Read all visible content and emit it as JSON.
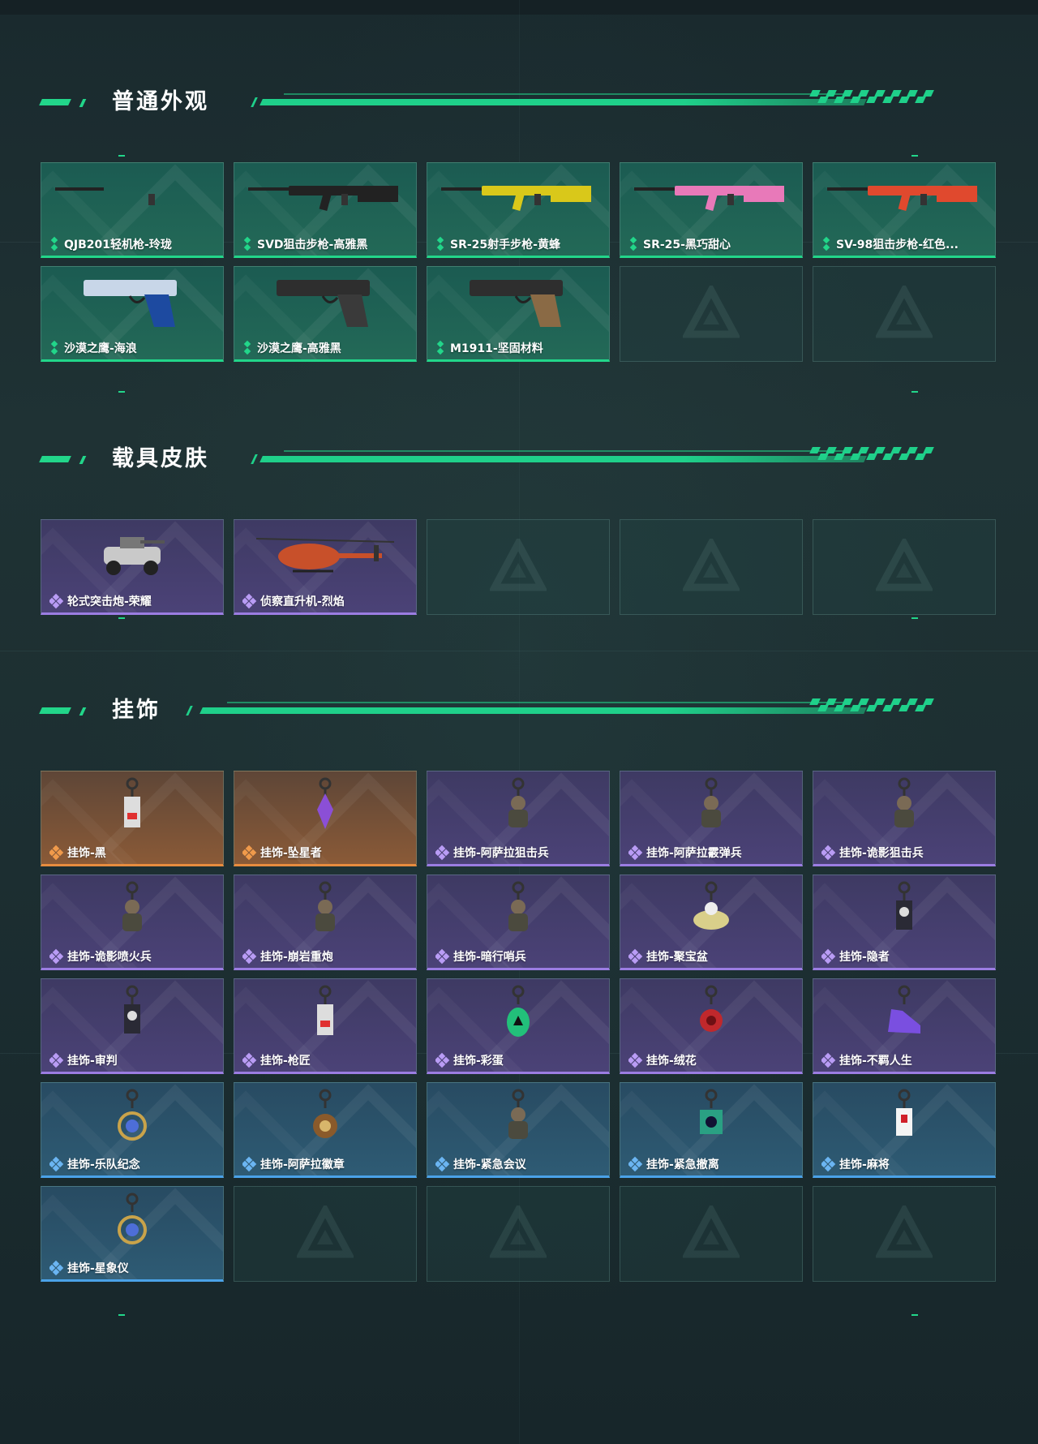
{
  "sections": {
    "skins": {
      "title": "普通外观",
      "items": [
        {
          "name": "QJB201轻机枪-玲珑",
          "rarity": "green",
          "icon": "machine-gun-icon"
        },
        {
          "name": "SVD狙击步枪-高雅黑",
          "rarity": "green",
          "icon": "sniper-rifle-icon"
        },
        {
          "name": "SR-25射手步枪-黄蜂",
          "rarity": "green",
          "icon": "marksman-rifle-yellow-icon"
        },
        {
          "name": "SR-25-黑巧甜心",
          "rarity": "green",
          "icon": "marksman-rifle-pink-icon"
        },
        {
          "name": "SV-98狙击步枪-红色...",
          "rarity": "green",
          "icon": "sniper-rifle-red-icon"
        },
        {
          "name": "沙漠之鹰-海浪",
          "rarity": "green",
          "icon": "pistol-blue-icon"
        },
        {
          "name": "沙漠之鹰-高雅黑",
          "rarity": "green",
          "icon": "pistol-black-icon"
        },
        {
          "name": "M1911-坚固材料",
          "rarity": "green",
          "icon": "pistol-m1911-icon"
        }
      ],
      "empty_slots": 2
    },
    "vehicles": {
      "title": "载具皮肤",
      "items": [
        {
          "name": "轮式突击炮-荣耀",
          "rarity": "purple",
          "icon": "armored-vehicle-icon"
        },
        {
          "name": "侦察直升机-烈焰",
          "rarity": "purple",
          "icon": "helicopter-icon"
        }
      ],
      "empty_slots": 3
    },
    "charms": {
      "title": "挂饰",
      "items": [
        {
          "name": "挂饰-黑",
          "rarity": "orange",
          "icon": "charm-tag-icon"
        },
        {
          "name": "挂饰-坠星者",
          "rarity": "orange",
          "icon": "charm-crystal-icon"
        },
        {
          "name": "挂饰-阿萨拉狙击兵",
          "rarity": "purple",
          "icon": "charm-soldier-icon"
        },
        {
          "name": "挂饰-阿萨拉霰弹兵",
          "rarity": "purple",
          "icon": "charm-soldier-icon"
        },
        {
          "name": "挂饰-诡影狙击兵",
          "rarity": "purple",
          "icon": "charm-ghost-icon"
        },
        {
          "name": "挂饰-诡影喷火兵",
          "rarity": "purple",
          "icon": "charm-flamer-icon"
        },
        {
          "name": "挂饰-崩岩重炮",
          "rarity": "purple",
          "icon": "charm-heavy-icon"
        },
        {
          "name": "挂饰-暗行哨兵",
          "rarity": "purple",
          "icon": "charm-sentry-icon"
        },
        {
          "name": "挂饰-聚宝盆",
          "rarity": "purple",
          "icon": "charm-treasure-bowl-icon"
        },
        {
          "name": "挂饰-隐者",
          "rarity": "purple",
          "icon": "charm-card-icon"
        },
        {
          "name": "挂饰-审判",
          "rarity": "purple",
          "icon": "charm-card-icon"
        },
        {
          "name": "挂饰-枪匠",
          "rarity": "purple",
          "icon": "charm-dogtag-icon"
        },
        {
          "name": "挂饰-彩蛋",
          "rarity": "purple",
          "icon": "charm-egg-icon"
        },
        {
          "name": "挂饰-绒花",
          "rarity": "purple",
          "icon": "charm-flower-icon"
        },
        {
          "name": "挂饰-不羁人生",
          "rarity": "purple",
          "icon": "charm-sneaker-icon"
        },
        {
          "name": "挂饰-乐队纪念",
          "rarity": "blue",
          "icon": "charm-badge-round-icon"
        },
        {
          "name": "挂饰-阿萨拉徽章",
          "rarity": "blue",
          "icon": "charm-medal-icon"
        },
        {
          "name": "挂饰-紧急会议",
          "rarity": "blue",
          "icon": "charm-figure-icon"
        },
        {
          "name": "挂饰-紧急撤离",
          "rarity": "blue",
          "icon": "charm-frame-icon"
        },
        {
          "name": "挂饰-麻将",
          "rarity": "blue",
          "icon": "charm-mahjong-icon"
        },
        {
          "name": "挂饰-星象仪",
          "rarity": "blue",
          "icon": "charm-orrery-icon"
        }
      ],
      "empty_slots": 4
    }
  },
  "colors": {
    "accent": "#22d68a",
    "green_rarity": "#22d68a",
    "purple_rarity": "#9b7de2",
    "orange_rarity": "#e78c3e",
    "blue_rarity": "#4aa2e8"
  }
}
